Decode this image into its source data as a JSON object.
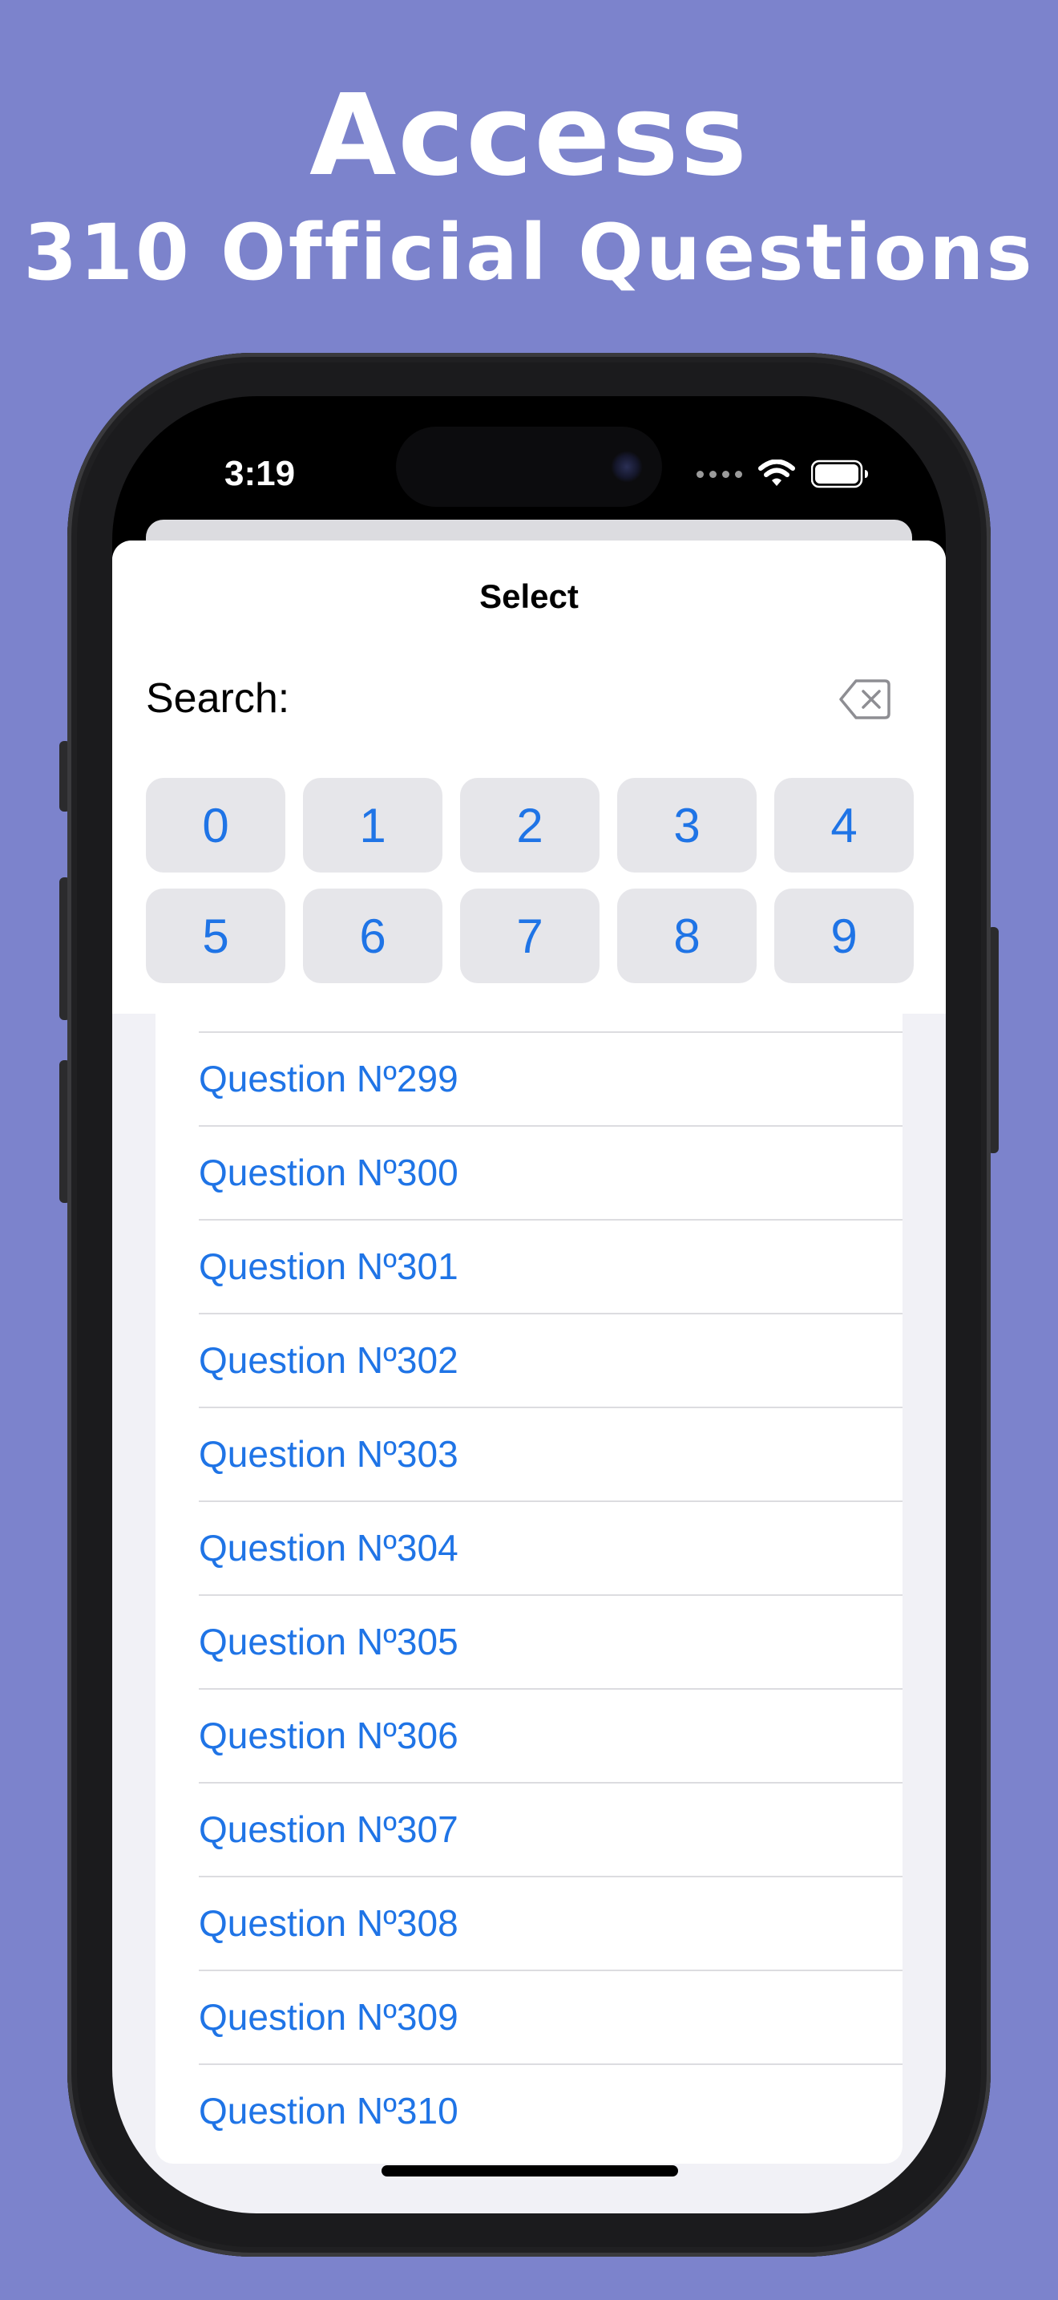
{
  "promo": {
    "title": "Access",
    "subtitle": "310 Official Questions"
  },
  "status_bar": {
    "time": "3:19"
  },
  "sheet": {
    "title": "Select",
    "search_label": "Search:"
  },
  "keypad": [
    "0",
    "1",
    "2",
    "3",
    "4",
    "5",
    "6",
    "7",
    "8",
    "9"
  ],
  "questions": [
    "Question Nº299",
    "Question Nº300",
    "Question Nº301",
    "Question Nº302",
    "Question Nº303",
    "Question Nº304",
    "Question Nº305",
    "Question Nº306",
    "Question Nº307",
    "Question Nº308",
    "Question Nº309",
    "Question Nº310"
  ],
  "colors": {
    "background": "#7c83cc",
    "accent": "#1f74e6",
    "key_fill": "#e6e6ea",
    "sheet_bg": "#f1f1f6"
  }
}
